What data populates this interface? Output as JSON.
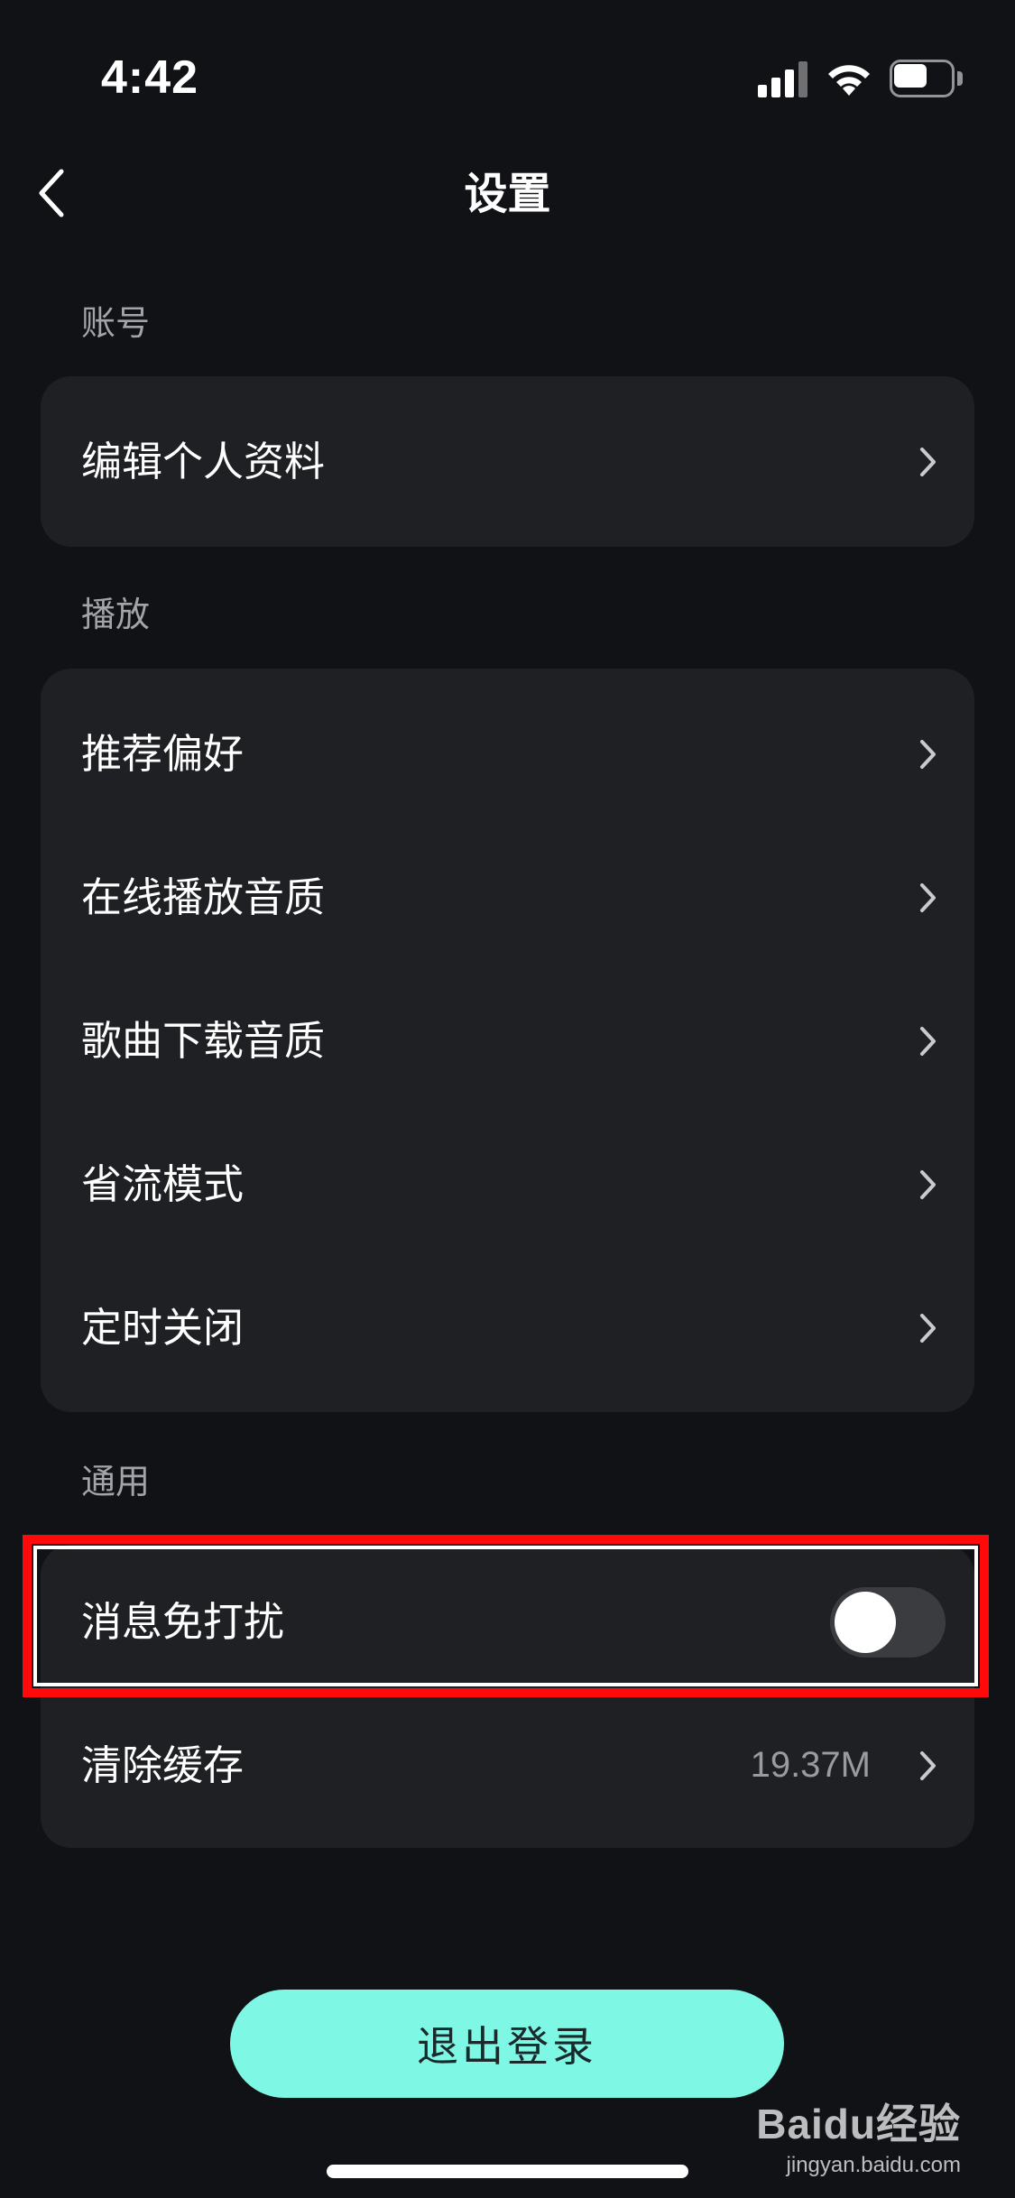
{
  "status_bar": {
    "time": "4:42"
  },
  "nav": {
    "title": "设置"
  },
  "sections": {
    "account": {
      "label": "账号",
      "items": [
        {
          "label": "编辑个人资料"
        }
      ]
    },
    "playback": {
      "label": "播放",
      "items": [
        {
          "label": "推荐偏好"
        },
        {
          "label": "在线播放音质"
        },
        {
          "label": "歌曲下载音质"
        },
        {
          "label": "省流模式"
        },
        {
          "label": "定时关闭"
        }
      ]
    },
    "general": {
      "label": "通用",
      "items": [
        {
          "label": "消息免打扰",
          "toggle_on": false
        },
        {
          "label": "清除缓存",
          "value": "19.37M"
        }
      ]
    }
  },
  "logout": {
    "label": "退出登录"
  },
  "watermark": {
    "logo": "Baidu经验",
    "url": "jingyan.baidu.com"
  },
  "colors": {
    "background": "#111216",
    "card": "#1f2023",
    "accent": "#7ef7e5",
    "highlight": "#ff0a0a"
  }
}
